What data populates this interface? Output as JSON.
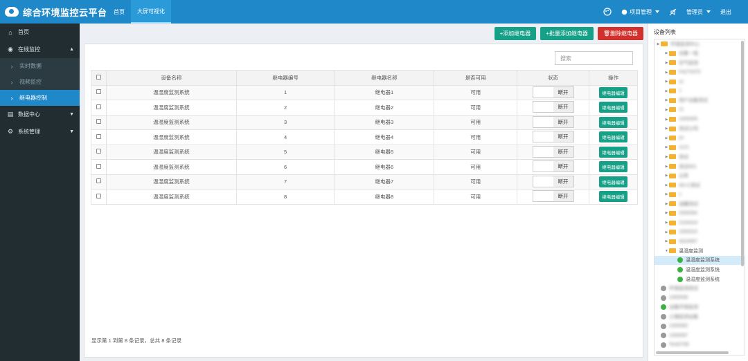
{
  "app": {
    "title": "综合环境监控云平台"
  },
  "topnav": [
    {
      "label": "首页",
      "active": false
    },
    {
      "label": "大屏可视化",
      "active": true
    }
  ],
  "topright": {
    "items_label": "项目管理",
    "user_label": "管理员",
    "logout_label": "退出"
  },
  "sidebar": [
    {
      "label": "首页",
      "icon": "home-icon",
      "expanded": false
    },
    {
      "label": "在线监控",
      "icon": "globe-icon",
      "expanded": true,
      "children": [
        {
          "label": "实时数据",
          "active": false
        },
        {
          "label": "视频监控",
          "active": false
        },
        {
          "label": "继电器控制",
          "active": true
        }
      ]
    },
    {
      "label": "数据中心",
      "icon": "calendar-icon",
      "expanded": false
    },
    {
      "label": "系统管理",
      "icon": "gear-icon",
      "expanded": false
    }
  ],
  "toolbar": {
    "add": "+添加继电器",
    "batch_add": "+批量添加继电器",
    "delete": "删除继电器"
  },
  "search": {
    "placeholder": "搜索"
  },
  "table": {
    "headers": [
      "设备名称",
      "继电器编号",
      "继电器名称",
      "是否可用",
      "状态",
      "操作"
    ],
    "rows": [
      {
        "device": "温湿度监测系统",
        "no": "1",
        "name": "继电器1",
        "usable": "可用",
        "state": "断开",
        "action": "继电器编辑"
      },
      {
        "device": "温湿度监测系统",
        "no": "2",
        "name": "继电器2",
        "usable": "可用",
        "state": "断开",
        "action": "继电器编辑"
      },
      {
        "device": "温湿度监测系统",
        "no": "3",
        "name": "继电器3",
        "usable": "可用",
        "state": "断开",
        "action": "继电器编辑"
      },
      {
        "device": "温湿度监测系统",
        "no": "4",
        "name": "继电器4",
        "usable": "可用",
        "state": "断开",
        "action": "继电器编辑"
      },
      {
        "device": "温湿度监测系统",
        "no": "5",
        "name": "继电器5",
        "usable": "可用",
        "state": "断开",
        "action": "继电器编辑"
      },
      {
        "device": "温湿度监测系统",
        "no": "6",
        "name": "继电器6",
        "usable": "可用",
        "state": "断开",
        "action": "继电器编辑"
      },
      {
        "device": "温湿度监测系统",
        "no": "7",
        "name": "继电器7",
        "usable": "可用",
        "state": "断开",
        "action": "继电器编辑"
      },
      {
        "device": "温湿度监测系统",
        "no": "8",
        "name": "继电器8",
        "usable": "可用",
        "state": "断开",
        "action": "继电器编辑"
      }
    ]
  },
  "footer": {
    "info": "显示第 1 到第 8 条记录，总共 8 条记录"
  },
  "devices": {
    "title": "设备列表",
    "tree": [
      {
        "label": "环境监测中心",
        "depth": 0,
        "type": "folder",
        "blurred": true
      },
      {
        "label": "设备一组",
        "depth": 1,
        "type": "folder",
        "blurred": true
      },
      {
        "label": "空气监测",
        "depth": 1,
        "type": "folder",
        "blurred": true
      },
      {
        "label": "F4270370",
        "depth": 1,
        "type": "folder",
        "blurred": true
      },
      {
        "label": "zz",
        "depth": 1,
        "type": "folder",
        "blurred": true
      },
      {
        "label": "1",
        "depth": 1,
        "type": "folder",
        "blurred": true
      },
      {
        "label": "用户设备测试",
        "depth": 1,
        "type": "folder",
        "blurred": true
      },
      {
        "label": "11",
        "depth": 1,
        "type": "folder",
        "blurred": true
      },
      {
        "label": "1000005",
        "depth": 1,
        "type": "folder",
        "blurred": true
      },
      {
        "label": "测试公司",
        "depth": 1,
        "type": "folder",
        "blurred": true
      },
      {
        "label": "yn",
        "depth": 1,
        "type": "folder",
        "blurred": true
      },
      {
        "label": "1121",
        "depth": 1,
        "type": "folder",
        "blurred": true
      },
      {
        "label": "测试",
        "depth": 1,
        "type": "folder",
        "blurred": true
      },
      {
        "label": "测试001",
        "depth": 1,
        "type": "folder",
        "blurred": true
      },
      {
        "label": "云库",
        "depth": 1,
        "type": "folder",
        "blurred": true
      },
      {
        "label": "4G-C测试",
        "depth": 1,
        "type": "folder",
        "blurred": true
      },
      {
        "label": "1",
        "depth": 1,
        "type": "folder",
        "blurred": true
      },
      {
        "label": "油罐测试",
        "depth": 1,
        "type": "folder",
        "blurred": true
      },
      {
        "label": "2000092",
        "depth": 1,
        "type": "folder",
        "blurred": true
      },
      {
        "label": "2104424",
        "depth": 1,
        "type": "folder",
        "blurred": true
      },
      {
        "label": "1000022",
        "depth": 1,
        "type": "folder",
        "blurred": true
      },
      {
        "label": "4024697",
        "depth": 1,
        "type": "folder",
        "blurred": true
      },
      {
        "label": "温湿度监测",
        "depth": 1,
        "type": "folder",
        "blurred": false,
        "open": true
      },
      {
        "label": "温湿度监测系统",
        "depth": 2,
        "type": "device",
        "status": "online",
        "blurred": false,
        "selected": true
      },
      {
        "label": "温湿度监测系统",
        "depth": 2,
        "type": "device",
        "status": "online",
        "blurred": false
      },
      {
        "label": "温湿度监测系统",
        "depth": 2,
        "type": "device",
        "status": "online",
        "blurred": false
      },
      {
        "label": "环境监测测试",
        "depth": 0,
        "type": "device",
        "status": "offline",
        "blurred": true
      },
      {
        "label": "1000058",
        "depth": 0,
        "type": "device",
        "status": "offline",
        "blurred": true
      },
      {
        "label": "设备环境监测",
        "depth": 0,
        "type": "device",
        "status": "online",
        "blurred": true
      },
      {
        "label": "土壤监测设备",
        "depth": 0,
        "type": "device",
        "status": "offline",
        "blurred": true
      },
      {
        "label": "1000082",
        "depth": 0,
        "type": "device",
        "status": "offline",
        "blurred": true
      },
      {
        "label": "1000097",
        "depth": 0,
        "type": "device",
        "status": "offline",
        "blurred": true
      },
      {
        "label": "Test0708",
        "depth": 0,
        "type": "device",
        "status": "offline",
        "blurred": true
      }
    ]
  },
  "colors": {
    "topbar": "#1e88c9",
    "sidebar": "#222d32",
    "teal": "#15a087",
    "red": "#d0312d",
    "active": "#1e88c9"
  }
}
